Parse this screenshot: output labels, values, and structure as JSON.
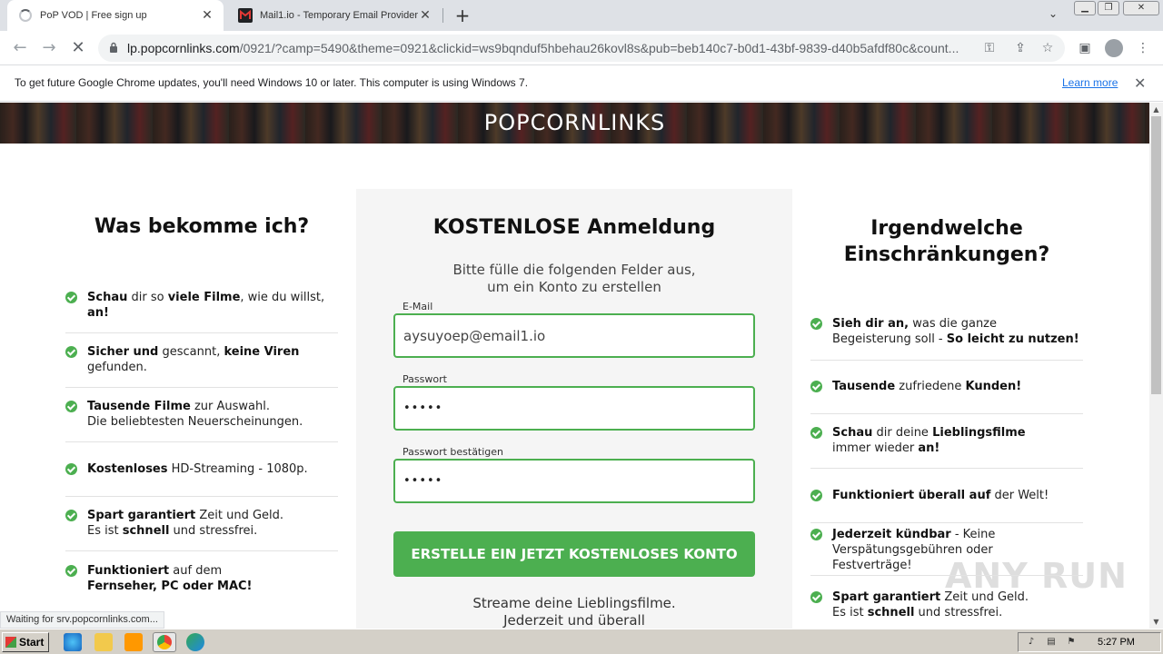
{
  "browser": {
    "tabs": [
      {
        "title": "PoP VOD | Free sign up",
        "icon": "loading-spinner-icon"
      },
      {
        "title": "Mail1.io - Temporary Email Provider",
        "icon": "mail1-favicon-icon"
      }
    ],
    "new_tab": "+",
    "url_domain": "lp.popcornlinks.com",
    "url_rest": "/0921/?camp=5490&theme=0921&clickid=ws9bqnduf5hbehau26kovl8s&pub=beb140c7-b0d1-43bf-9839-d40b5afdf80c&count...",
    "status_text": "Waiting for srv.popcornlinks.com..."
  },
  "infobar": {
    "message": "To get future Google Chrome updates, you'll need Windows 10 or later. This computer is using Windows 7.",
    "link": "Learn more"
  },
  "page": {
    "logo": "POPCORNLINKS",
    "left": {
      "title": "Was bekomme ich?",
      "items": [
        {
          "l1": [
            [
              "b",
              "Schau"
            ],
            [
              "n",
              " dir so "
            ],
            [
              "b",
              "viele Filme"
            ],
            [
              "n",
              ", wie du willst,"
            ]
          ],
          "l2": [
            [
              "b",
              "an!"
            ]
          ]
        },
        {
          "l1": [
            [
              "b",
              "Sicher und"
            ],
            [
              "n",
              " gescannt, "
            ],
            [
              "b",
              "keine Viren"
            ]
          ],
          "l2": [
            [
              "n",
              "gefunden."
            ]
          ]
        },
        {
          "l1": [
            [
              "b",
              "Tausende Filme"
            ],
            [
              "n",
              " zur Auswahl."
            ]
          ],
          "l2": [
            [
              "n",
              "Die beliebtesten Neuerscheinungen."
            ]
          ]
        },
        {
          "l1": [
            [
              "b",
              "Kostenloses"
            ],
            [
              "n",
              " HD-Streaming - 1080p."
            ]
          ],
          "l2": []
        },
        {
          "l1": [
            [
              "b",
              "Spart garantiert"
            ],
            [
              "n",
              " Zeit und Geld."
            ]
          ],
          "l2": [
            [
              "n",
              "Es ist "
            ],
            [
              "b",
              "schnell"
            ],
            [
              "n",
              " und stressfrei."
            ]
          ]
        },
        {
          "l1": [
            [
              "b",
              "Funktioniert"
            ],
            [
              "n",
              " auf dem"
            ]
          ],
          "l2": [
            [
              "b",
              "Fernseher, PC oder MAC!"
            ]
          ]
        }
      ]
    },
    "form": {
      "title": "KOSTENLOSE Anmeldung",
      "subtitle_1": "Bitte fülle die folgenden Felder aus,",
      "subtitle_2": "um ein Konto zu erstellen",
      "email_label": "E-Mail",
      "email_value": "aysuyoep@email1.io",
      "password_label": "Passwort",
      "password_value": "•••••",
      "confirm_label": "Passwort bestätigen",
      "confirm_value": "•••••",
      "submit": "ERSTELLE EIN JETZT KOSTENLOSES KONTO",
      "footer_1": "Streame deine Lieblingsfilme.",
      "footer_2": "Jederzeit und überall"
    },
    "right": {
      "title_1": "Irgendwelche",
      "title_2": "Einschränkungen?",
      "items": [
        {
          "l1": [
            [
              "b",
              "Sieh dir an,"
            ],
            [
              "n",
              " was die ganze"
            ]
          ],
          "l2": [
            [
              "n",
              "Begeisterung soll - "
            ],
            [
              "b",
              "So leicht zu nutzen!"
            ]
          ],
          "l3": []
        },
        {
          "l1": [
            [
              "b",
              "Tausende"
            ],
            [
              "n",
              " zufriedene "
            ],
            [
              "b",
              "Kunden!"
            ]
          ],
          "l2": [],
          "l3": []
        },
        {
          "l1": [
            [
              "b",
              "Schau"
            ],
            [
              "n",
              " dir deine "
            ],
            [
              "b",
              "Lieblingsfilme"
            ]
          ],
          "l2": [
            [
              "n",
              "immer wieder "
            ],
            [
              "b",
              "an!"
            ]
          ],
          "l3": []
        },
        {
          "l1": [
            [
              "b",
              "Funktioniert überall auf"
            ],
            [
              "n",
              " der Welt!"
            ]
          ],
          "l2": [],
          "l3": []
        },
        {
          "l1": [
            [
              "b",
              "Jederzeit kündbar"
            ],
            [
              "n",
              " - Keine"
            ]
          ],
          "l2": [
            [
              "n",
              "Verspätungsgebühren oder"
            ]
          ],
          "l3": [
            [
              "n",
              "Festverträge!"
            ]
          ]
        },
        {
          "l1": [
            [
              "b",
              "Spart garantiert"
            ],
            [
              "n",
              " Zeit und Geld."
            ]
          ],
          "l2": [
            [
              "n",
              "Es ist "
            ],
            [
              "b",
              "schnell"
            ],
            [
              "n",
              " und stressfrei."
            ]
          ],
          "l3": []
        }
      ]
    },
    "watermark": "ANY RUN"
  },
  "taskbar": {
    "start": "Start",
    "time": "5:27 PM"
  },
  "colors": {
    "accent_green": "#4caf50",
    "link_blue": "#1a73e8"
  }
}
